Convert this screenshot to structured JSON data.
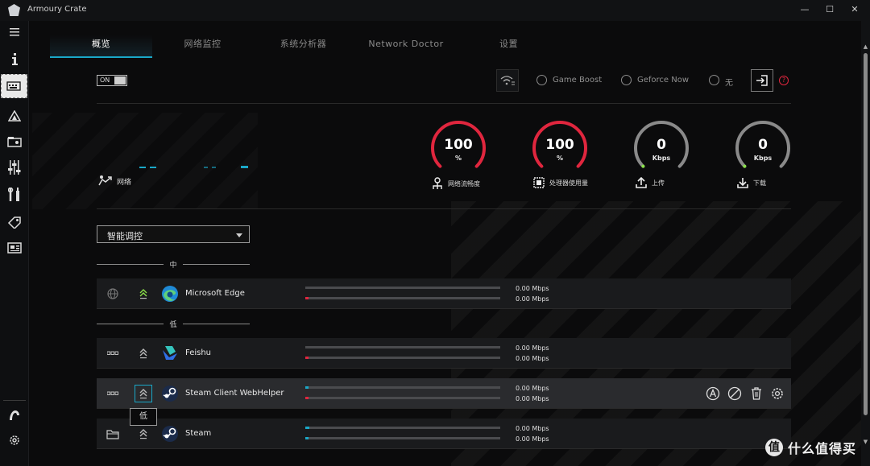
{
  "window": {
    "title": "Armoury Crate",
    "controls": {
      "minimize": "—",
      "maximize": "☐",
      "close": "✕"
    }
  },
  "sidebar": {
    "items": [
      {
        "icon": "menu-icon",
        "label": "≡"
      },
      {
        "icon": "info-icon",
        "label": "i"
      },
      {
        "icon": "keyboard-icon",
        "label": "⌨"
      },
      {
        "icon": "aura-icon",
        "label": "△"
      },
      {
        "icon": "gamevisual-icon",
        "label": "▤"
      },
      {
        "icon": "equalizer-icon",
        "label": "⫶"
      },
      {
        "icon": "tools-icon",
        "label": "✱"
      },
      {
        "icon": "deals-icon",
        "label": "◇"
      },
      {
        "icon": "news-icon",
        "label": "▦"
      },
      {
        "icon": "user-icon",
        "label": "◔"
      },
      {
        "icon": "settings-icon",
        "label": "⚙"
      }
    ]
  },
  "tabs": [
    {
      "label": "概览",
      "active": true
    },
    {
      "label": "网络监控",
      "active": false
    },
    {
      "label": "系统分析器",
      "active": false
    },
    {
      "label": "Network Doctor",
      "active": false
    },
    {
      "label": "设置",
      "active": false
    }
  ],
  "toggle": {
    "label": "ON",
    "state": "on"
  },
  "modes": [
    {
      "label": "Game Boost",
      "selected": false
    },
    {
      "label": "Geforce Now",
      "selected": false
    },
    {
      "label": "无",
      "selected": false
    }
  ],
  "help": "?",
  "network": {
    "label": "网络"
  },
  "gauges": [
    {
      "value": "100",
      "unit": "%",
      "caption": "网络流畅度",
      "icon": "network-smooth-icon",
      "level": 1.0,
      "color": "#e0263e"
    },
    {
      "value": "100",
      "unit": "%",
      "caption": "处理器使用量",
      "icon": "cpu-icon",
      "level": 1.0,
      "color": "#e0263e"
    },
    {
      "value": "0",
      "unit": "Kbps",
      "caption": "上传",
      "icon": "upload-icon",
      "level": 0.0,
      "color": "#9a9a9a"
    },
    {
      "value": "0",
      "unit": "Kbps",
      "caption": "下载",
      "icon": "download-icon",
      "level": 0.0,
      "color": "#9a9a9a"
    }
  ],
  "dropdown": {
    "value": "智能调控"
  },
  "groups": {
    "medium": "中",
    "low": "低"
  },
  "apps": [
    {
      "name": "Microsoft Edge",
      "up": "0.00 Mbps",
      "down": "0.00 Mbps",
      "up_fill": 0.0,
      "down_fill": 0.01,
      "down_color": "#e0263e"
    },
    {
      "name": "Feishu",
      "up": "0.00 Mbps",
      "down": "0.00 Mbps",
      "up_fill": 0.0,
      "down_fill": 0.01,
      "down_color": "#e0263e"
    },
    {
      "name": "Steam Client WebHelper",
      "up": "0.00 Mbps",
      "down": "0.00 Mbps",
      "up_fill": 0.01,
      "down_fill": 0.01,
      "up_color": "#1aa8c8",
      "down_color": "#e0263e"
    },
    {
      "name": "Steam",
      "up": "0.00 Mbps",
      "down": "0.00 Mbps",
      "up_fill": 0.02,
      "down_fill": 0.01,
      "up_color": "#1aa8c8",
      "down_color": "#1aa8c8"
    }
  ],
  "tooltip": "低",
  "watermark": {
    "badge": "值",
    "text": "什么值得买"
  }
}
